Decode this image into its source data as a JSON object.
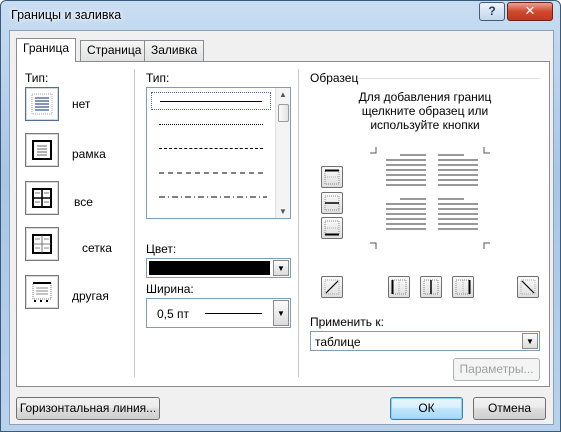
{
  "window": {
    "title": "Границы и заливка"
  },
  "titlebar": {
    "help_icon": "?",
    "close_icon": "✕"
  },
  "tabs": [
    {
      "label": "Граница",
      "active": true
    },
    {
      "label": "Страница",
      "active": false
    },
    {
      "label": "Заливка",
      "active": false
    }
  ],
  "settings": {
    "label": "Тип:",
    "items": [
      {
        "name": "нет",
        "selected": true
      },
      {
        "name": "рамка",
        "selected": false
      },
      {
        "name": "все",
        "selected": false
      },
      {
        "name": "сетка",
        "selected": false
      },
      {
        "name": "другая",
        "selected": false
      }
    ]
  },
  "style": {
    "label": "Тип:",
    "items": [
      "solid",
      "dotted",
      "dashed-small",
      "dashed",
      "dash-dot"
    ],
    "selected_index": 0
  },
  "color": {
    "label": "Цвет:",
    "value": "#000000"
  },
  "width": {
    "label": "Ширина:",
    "value": "0,5 пт"
  },
  "preview": {
    "label": "Образец",
    "hint_line1": "Для добавления границ",
    "hint_line2": "щелкните образец или",
    "hint_line3": "используйте кнопки"
  },
  "apply_to": {
    "label": "Применить к:",
    "value": "таблице"
  },
  "buttons": {
    "options": "Параметры...",
    "horizontal_line": "Горизонтальная линия...",
    "ok": "ОК",
    "cancel": "Отмена"
  },
  "colors": {
    "accent": "#3c7fb1",
    "close_red": "#c3381f"
  }
}
